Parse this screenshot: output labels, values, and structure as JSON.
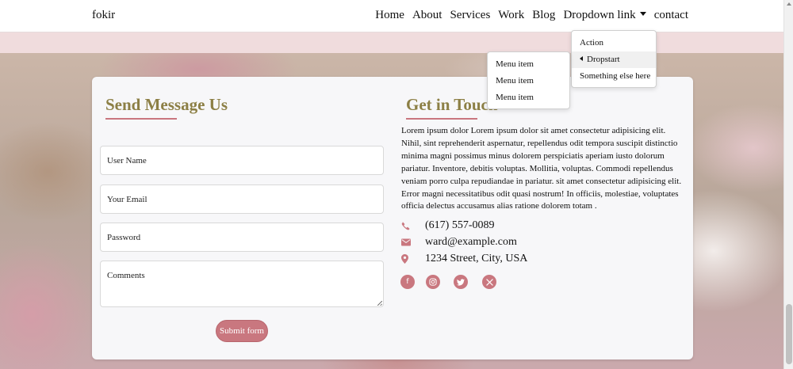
{
  "navbar": {
    "brand": "fokir",
    "links": [
      "Home",
      "About",
      "Services",
      "Work",
      "Blog",
      "Dropdown link",
      "contact"
    ]
  },
  "dropdown": {
    "items": [
      "Action",
      "Dropstart",
      "Something else here"
    ],
    "submenu": [
      "Menu item",
      "Menu item",
      "Menu item"
    ]
  },
  "form": {
    "title": "Send Message Us",
    "username_placeholder": "User Name",
    "email_placeholder": "Your Email",
    "password_placeholder": "Password",
    "comments_placeholder": "Comments",
    "submit_label": "Submit form"
  },
  "contact": {
    "title": "Get in Touch",
    "body": "Lorem ipsum dolor Lorem ipsum dolor sit amet consectetur adipisicing elit. Nihil, sint reprehenderit aspernatur, repellendus odit tempora suscipit distinctio minima magni possimus minus dolorem perspiciatis aperiam iusto dolorum pariatur. Inventore, debitis voluptas. Mollitia, voluptas. Commodi repellendus veniam porro culpa repudiandae in pariatur. sit amet consectetur adipisicing elit. Error magni necessitatibus odit quasi nostrum! In officiis, molestiae, voluptates officia delectus accusamus alias ratione dolorem totam .",
    "phone": "(617) 557-0089",
    "email": "ward@example.com",
    "address": "1234 Street, City, USA",
    "icons": [
      "phone-icon",
      "envelope-icon",
      "map-pin-icon"
    ],
    "socials": [
      "facebook-icon",
      "instagram-icon",
      "twitter-icon",
      "x-icon"
    ]
  },
  "colors": {
    "accent": "#c9777f",
    "heading": "#8c7f45",
    "band": "#f0dcdd"
  }
}
